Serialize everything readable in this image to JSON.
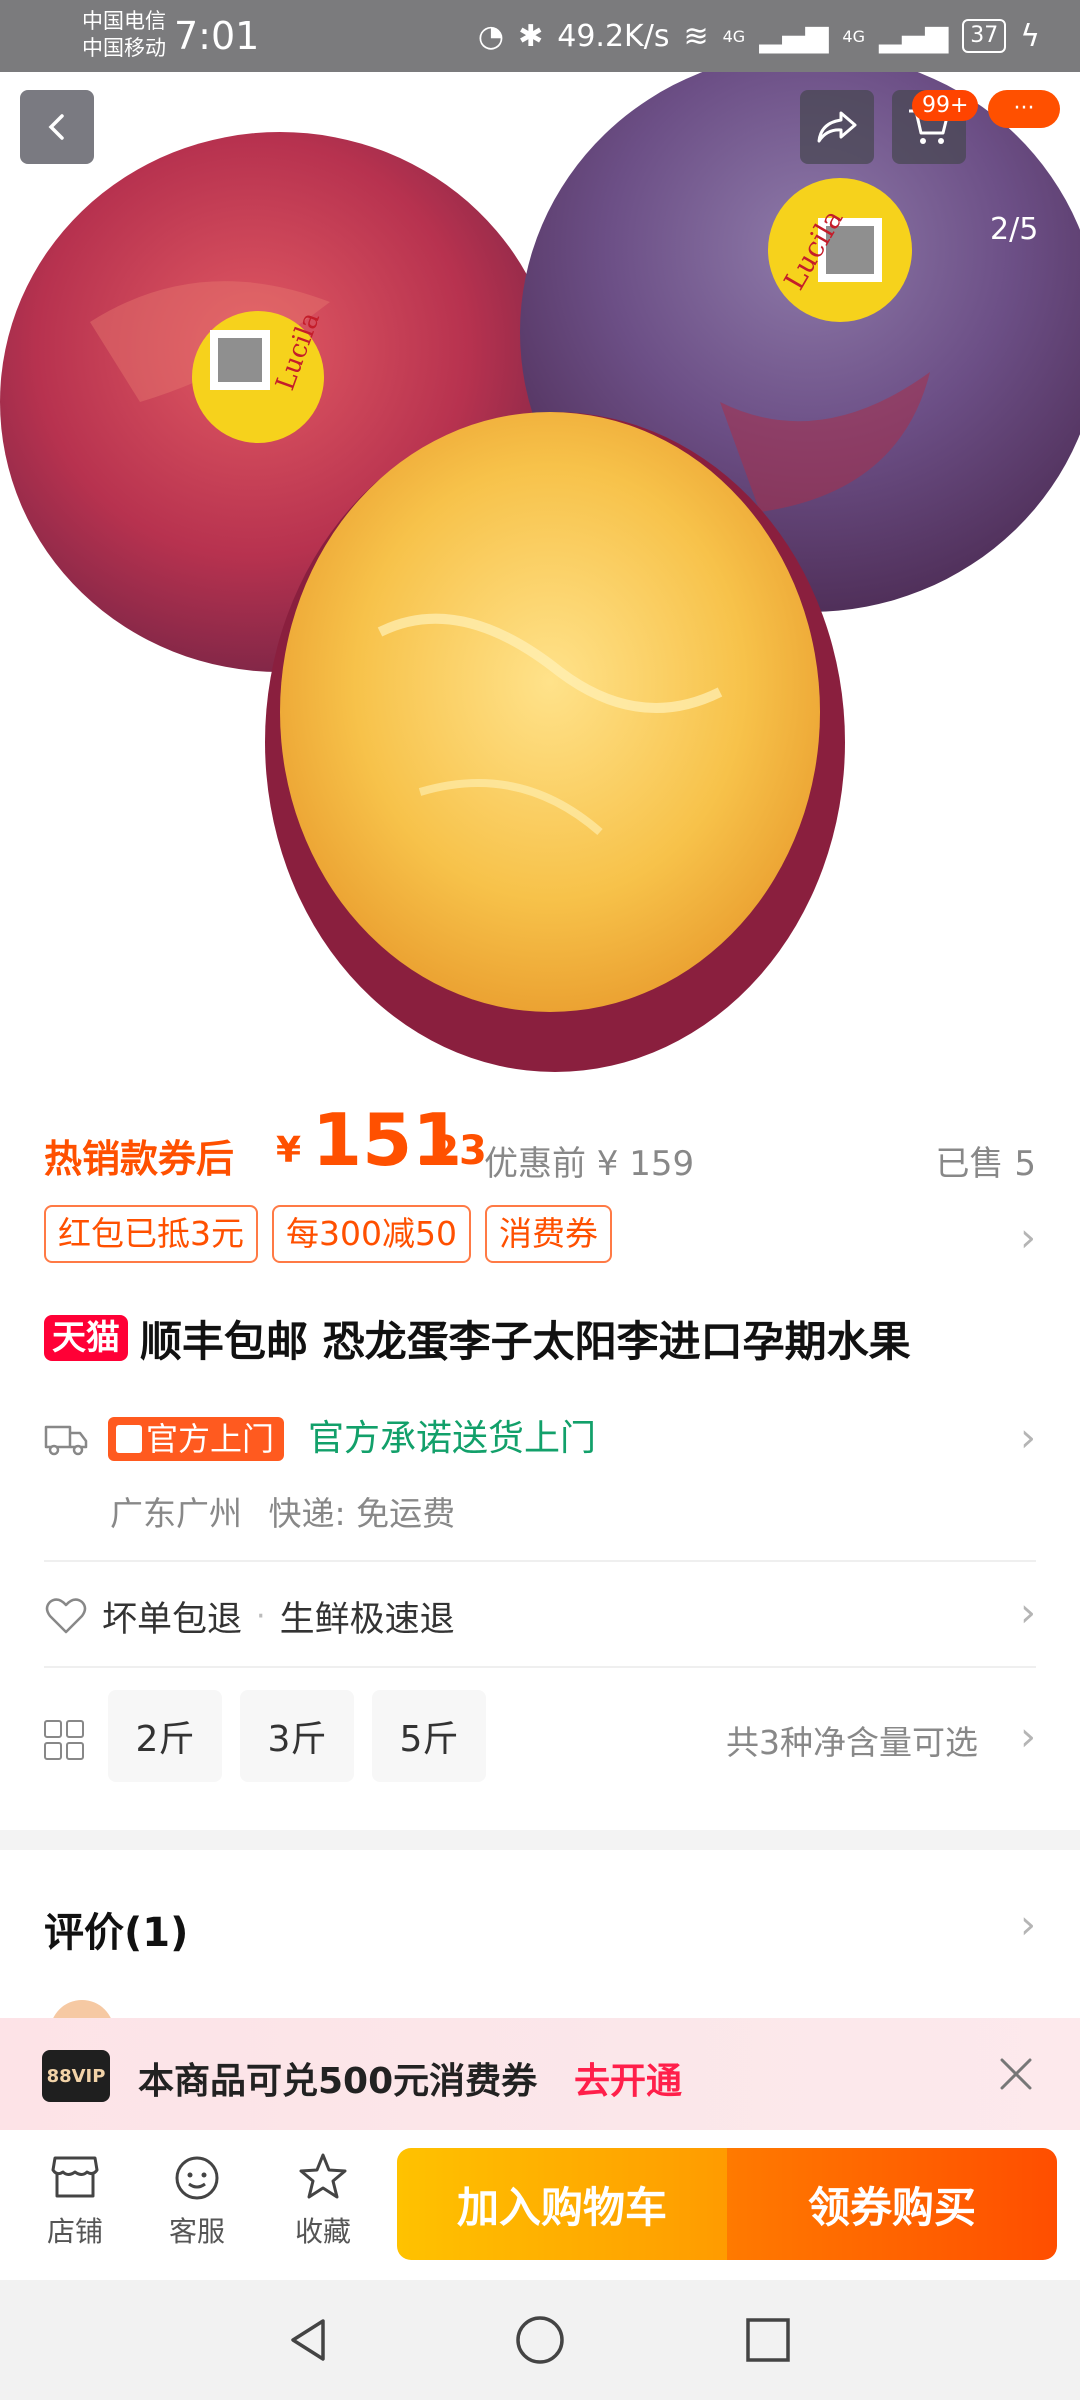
{
  "status_bar": {
    "carrier_1": "中国电信",
    "carrier_2": "中国移动",
    "time": "7:01",
    "net_speed": "49.2K/s",
    "signal_1": "4G",
    "signal_2": "4G",
    "battery": "37"
  },
  "header": {
    "cart_badge": "99+",
    "image_counter": "2/5",
    "icons": [
      "back-icon",
      "share-icon",
      "cart-icon",
      "more-icon"
    ]
  },
  "product_image": {
    "sticker_text": "Lucila"
  },
  "price": {
    "label": "热销款券后",
    "currency": "¥",
    "integer": "151",
    "decimal": ".23",
    "original": "优惠前 ¥ 159",
    "sold": "已售 5"
  },
  "coupons": [
    "红包已抵3元",
    "每300减50",
    "消费券"
  ],
  "title": {
    "badge": "天猫",
    "text": "顺丰包邮 恐龙蛋李子太阳李进口孕期水果"
  },
  "delivery": {
    "badge": "官方上门",
    "text": "官方承诺送货上门",
    "location": "广东广州",
    "shipping": "快递: 免运费"
  },
  "guarantee": {
    "item_1": "坏单包退",
    "separator": "·",
    "item_2": "生鲜极速退"
  },
  "specs": {
    "options": [
      "2斤",
      "3斤",
      "5斤"
    ],
    "note": "共3种净含量可选"
  },
  "reviews": {
    "title": "评价(1)"
  },
  "vip_banner": {
    "logo": "88VIP",
    "text": "本商品可兑500元消费券",
    "link": "去开通"
  },
  "bottom_bar": {
    "shop": "店铺",
    "service": "客服",
    "favorite": "收藏",
    "add_to_cart": "加入购物车",
    "buy": "领券购买"
  },
  "colors": {
    "accent": "#ff5000",
    "tmall_red": "#ff0036",
    "official_green": "#12a06a",
    "cart_button": "#ffb000",
    "buy_button": "#ff5a00"
  }
}
